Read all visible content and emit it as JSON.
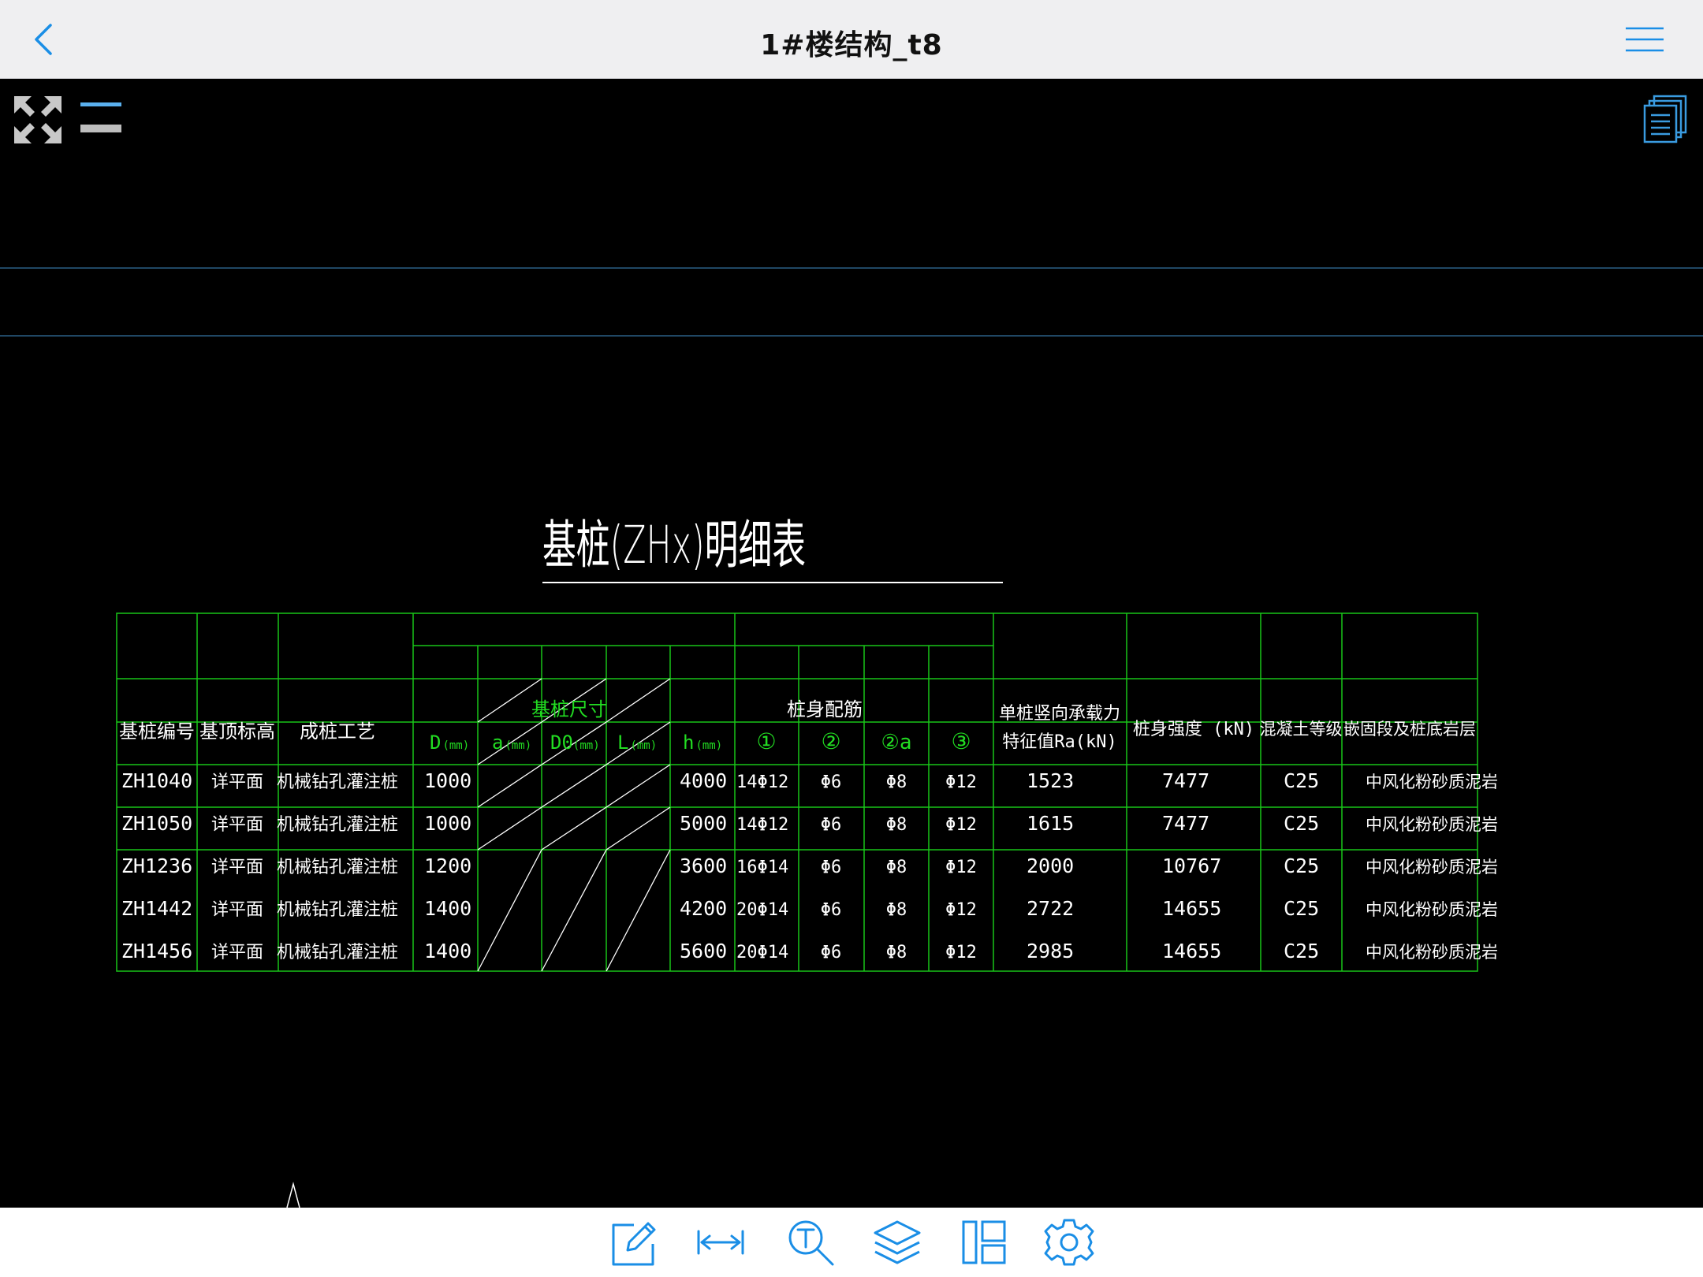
{
  "header": {
    "title": "1#楼结构_t8"
  },
  "drawing": {
    "title": "基桩(ZHx)明细表",
    "columns": {
      "pile_no": "基桩编号",
      "top_elev": "基顶标高",
      "method": "成桩工艺",
      "size_group": "基桩尺寸",
      "rebar_group": "桩身配筋",
      "capacity_line1": "单桩竖向承载力",
      "capacity_line2": "特征值Ra(kN)",
      "strength": "桩身强度 (kN)",
      "concrete": "混凝土等级",
      "stratum": "嵌固段及桩底岩层"
    },
    "subcolumns": {
      "D": "D",
      "a": "a",
      "D0": "D0",
      "L": "L",
      "h": "h",
      "unit": "(mm)",
      "r1": "①",
      "r2": "②",
      "r2a": "②a",
      "r3": "③"
    },
    "rows": [
      {
        "id": "ZH1040",
        "top": "详平面",
        "method": "机械钻孔灌注桩",
        "D": "1000",
        "h": "4000",
        "r1": "14Φ12",
        "r2": "Φ6",
        "r2a": "Φ8",
        "r3": "Φ12",
        "ra": "1523",
        "strength": "7477",
        "concrete": "C25",
        "stratum": "中风化粉砂质泥岩"
      },
      {
        "id": "ZH1050",
        "top": "详平面",
        "method": "机械钻孔灌注桩",
        "D": "1000",
        "h": "5000",
        "r1": "14Φ12",
        "r2": "Φ6",
        "r2a": "Φ8",
        "r3": "Φ12",
        "ra": "1615",
        "strength": "7477",
        "concrete": "C25",
        "stratum": "中风化粉砂质泥岩"
      },
      {
        "id": "ZH1236",
        "top": "详平面",
        "method": "机械钻孔灌注桩",
        "D": "1200",
        "h": "3600",
        "r1": "16Φ14",
        "r2": "Φ6",
        "r2a": "Φ8",
        "r3": "Φ12",
        "ra": "2000",
        "strength": "10767",
        "concrete": "C25",
        "stratum": "中风化粉砂质泥岩"
      },
      {
        "id": "ZH1442",
        "top": "详平面",
        "method": "机械钻孔灌注桩",
        "D": "1400",
        "h": "4200",
        "r1": "20Φ14",
        "r2": "Φ6",
        "r2a": "Φ8",
        "r3": "Φ12",
        "ra": "2722",
        "strength": "14655",
        "concrete": "C25",
        "stratum": "中风化粉砂质泥岩"
      },
      {
        "id": "ZH1456",
        "top": "详平面",
        "method": "机械钻孔灌注桩",
        "D": "1400",
        "h": "5600",
        "r1": "20Φ14",
        "r2": "Φ6",
        "r2a": "Φ8",
        "r3": "Φ12",
        "ra": "2985",
        "strength": "14655",
        "concrete": "C25",
        "stratum": "中风化粉砂质泥岩"
      }
    ]
  },
  "colors": {
    "cad_line": "#19c419",
    "cad_text": "#ffffff",
    "cad_subheader": "#22dd22",
    "accent": "#1a8ee6",
    "separator": "#2a5f86"
  },
  "icons": {
    "back": "chevron-left-icon",
    "menu": "hamburger-menu-icon",
    "fullscreen": "expand-arrows-icon",
    "layers_bar": "layer-bars-icon",
    "sheets": "stacked-sheets-icon",
    "toolbar": [
      "edit-pencil-icon",
      "measure-distance-icon",
      "text-search-icon",
      "layers-icon",
      "layout-icon",
      "settings-gear-icon"
    ]
  }
}
